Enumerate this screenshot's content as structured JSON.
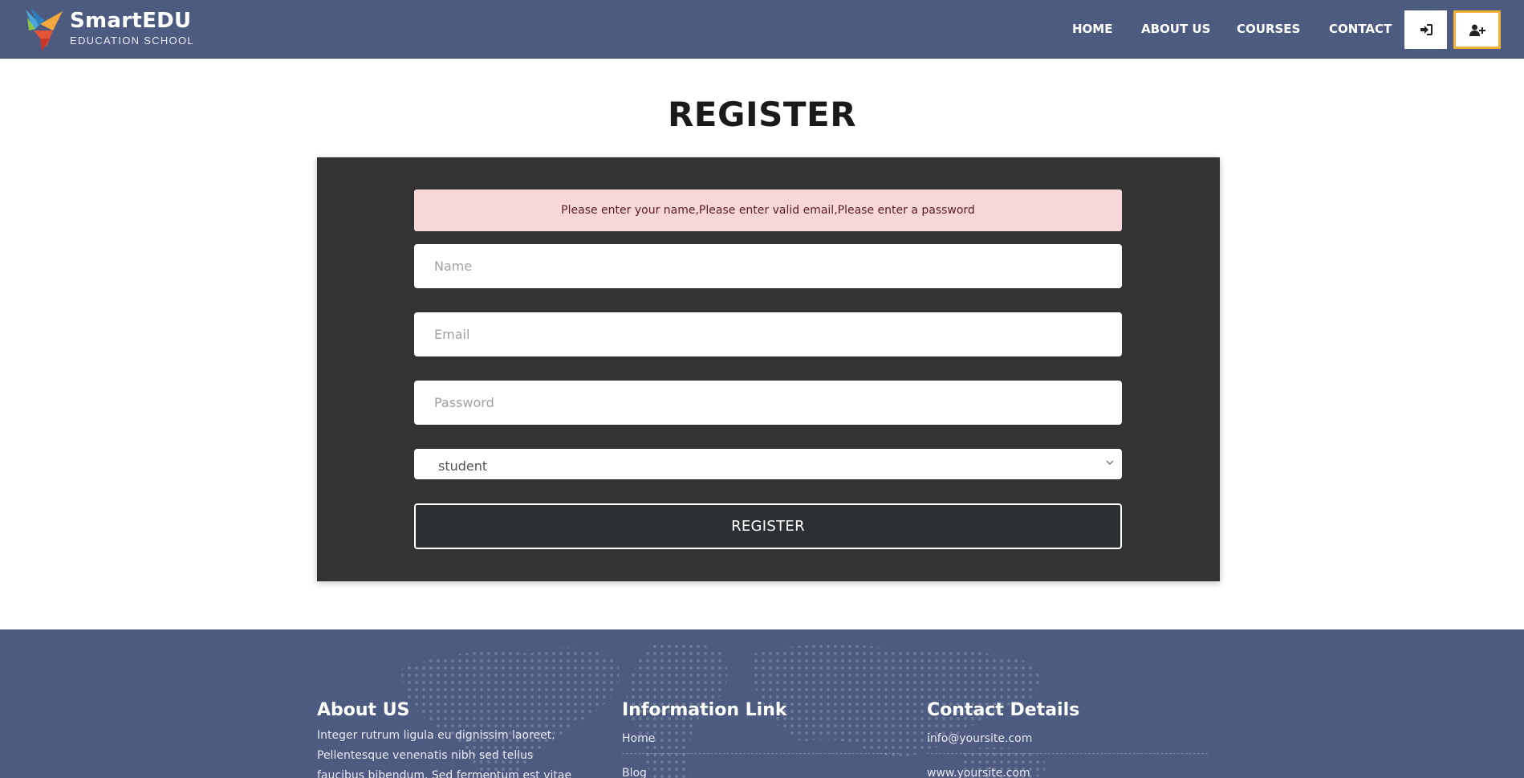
{
  "header": {
    "brand_name": "SmartEDU",
    "brand_subtitle": "EDUCATION SCHOOL",
    "nav": [
      {
        "label": "HOME"
      },
      {
        "label": "ABOUT US"
      },
      {
        "label": "COURSES"
      },
      {
        "label": "CONTACT"
      }
    ],
    "login_icon": "sign-in-icon",
    "register_icon": "user-plus-icon"
  },
  "main": {
    "title": "REGISTER",
    "alert": "Please enter your name,Please enter valid email,Please enter a password",
    "name_placeholder": "Name",
    "email_placeholder": "Email",
    "password_placeholder": "Password",
    "role_selected": "student",
    "submit_label": "REGISTER"
  },
  "footer": {
    "about": {
      "heading": "About US",
      "text": "Integer rutrum ligula eu dignissim laoreet. Pellentesque venenatis nibh sed tellus faucibus bibendum. Sed fermentum est vitae rhoncus"
    },
    "links": {
      "heading": "Information Link",
      "items": [
        {
          "label": "Home"
        },
        {
          "label": "Blog"
        }
      ]
    },
    "contact": {
      "heading": "Contact Details",
      "items": [
        {
          "label": "info@yoursite.com"
        },
        {
          "label": "www.yoursite.com"
        }
      ]
    }
  },
  "colors": {
    "header_bg": "#4c5b7f",
    "panel_bg": "#333333",
    "alert_bg": "#f8d7da",
    "accent": "#f0b035"
  }
}
